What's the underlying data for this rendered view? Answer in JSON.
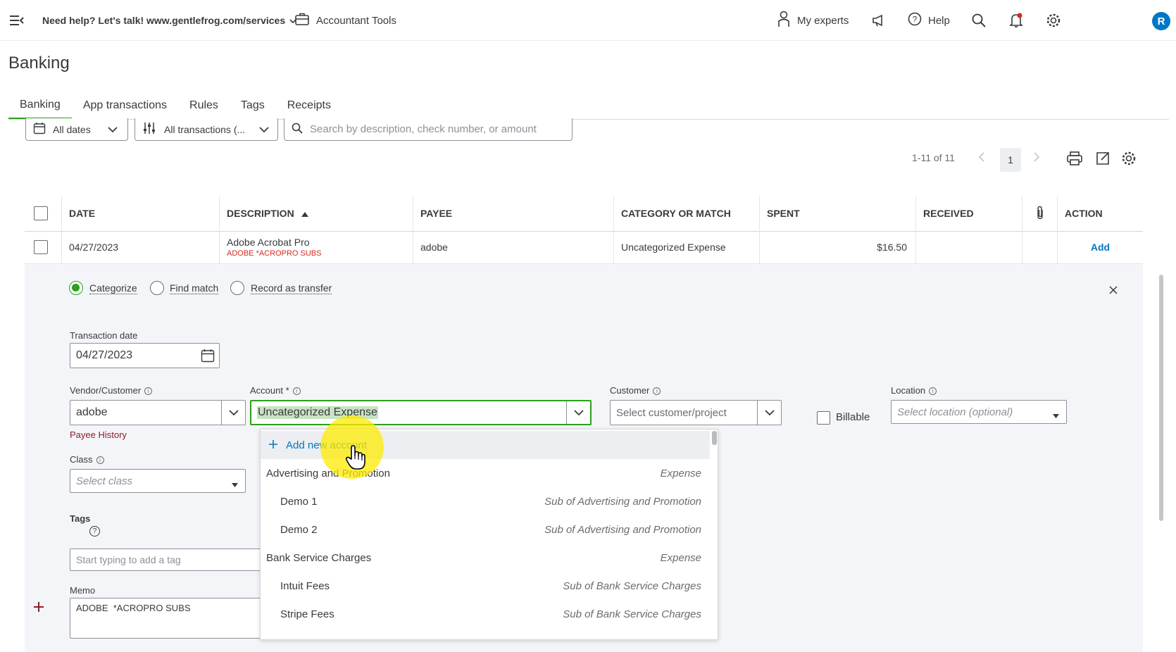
{
  "topbar": {
    "help_text": "Need help? Let's talk! www.gentlefrog.com/services",
    "accountant_tools": "Accountant Tools",
    "my_experts": "My experts",
    "help": "Help",
    "avatar_letter": "R"
  },
  "page": {
    "title": "Banking",
    "tabs": [
      "Banking",
      "App transactions",
      "Rules",
      "Tags",
      "Receipts"
    ]
  },
  "filters": {
    "dates": "All dates",
    "transactions": "All transactions (...",
    "search_placeholder": "Search by description, check number, or amount"
  },
  "pagination": {
    "range": "1-11 of 11",
    "current_page": "1"
  },
  "table": {
    "headers": [
      "DATE",
      "DESCRIPTION",
      "PAYEE",
      "CATEGORY OR MATCH",
      "SPENT",
      "RECEIVED",
      "ACTION"
    ],
    "row": {
      "date": "04/27/2023",
      "description": "Adobe Acrobat Pro",
      "description_sub": "ADOBE *ACROPRO SUBS",
      "payee": "adobe",
      "category": "Uncategorized Expense",
      "spent": "$16.50",
      "received": "",
      "action": "Add"
    }
  },
  "panel": {
    "modes": [
      "Categorize",
      "Find match",
      "Record as transfer"
    ],
    "transaction_date_label": "Transaction date",
    "transaction_date": "04/27/2023",
    "vendor_label": "Vendor/Customer",
    "vendor_value": "adobe",
    "payee_history": "Payee History",
    "account_label": "Account *",
    "account_value": "Uncategorized Expense",
    "customer_label": "Customer",
    "customer_placeholder": "Select customer/project",
    "billable_label": "Billable",
    "location_label": "Location",
    "location_placeholder": "Select location (optional)",
    "class_label": "Class",
    "class_placeholder": "Select class",
    "tags_label": "Tags",
    "tags_placeholder": "Start typing to add a tag",
    "memo_label": "Memo",
    "memo_value": "ADOBE  *ACROPRO SUBS"
  },
  "account_dropdown": {
    "add_new": "Add new account",
    "items": [
      {
        "name": "Advertising and Promotion",
        "type": "Expense",
        "indent": false
      },
      {
        "name": "Demo 1",
        "type": "Sub of Advertising and Promotion",
        "indent": true
      },
      {
        "name": "Demo 2",
        "type": "Sub of Advertising and Promotion",
        "indent": true
      },
      {
        "name": "Bank Service Charges",
        "type": "Expense",
        "indent": false
      },
      {
        "name": "Intuit Fees",
        "type": "Sub of Bank Service Charges",
        "indent": true
      },
      {
        "name": "Stripe Fees",
        "type": "Sub of Bank Service Charges",
        "indent": true
      }
    ]
  },
  "colors": {
    "accent_green": "#2ca01c",
    "link_blue": "#0077c5",
    "payee_red": "#8d1c2c"
  }
}
